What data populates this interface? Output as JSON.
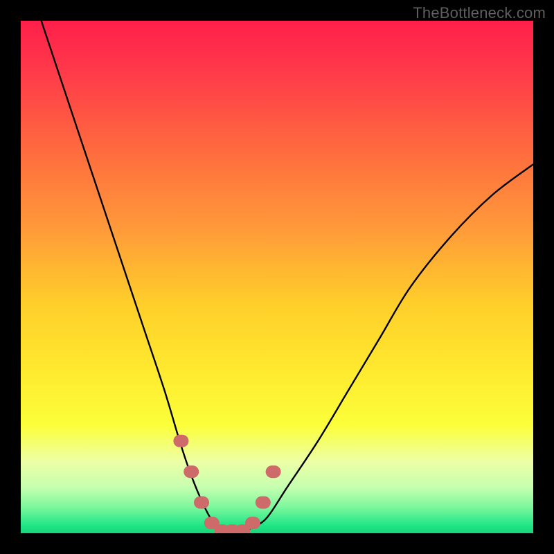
{
  "watermark": "TheBottleneck.com",
  "chart_data": {
    "type": "line",
    "title": "",
    "xlabel": "",
    "ylabel": "",
    "xlim": [
      0,
      100
    ],
    "ylim": [
      0,
      100
    ],
    "grid": false,
    "series": [
      {
        "name": "bottleneck-curve",
        "x": [
          4,
          8,
          12,
          16,
          20,
          24,
          28,
          31,
          33,
          35,
          37,
          39,
          41,
          43,
          45,
          48,
          52,
          58,
          64,
          70,
          76,
          84,
          92,
          100
        ],
        "y": [
          100,
          88,
          76,
          64,
          52,
          40,
          28,
          18,
          12,
          7,
          3,
          1,
          0.5,
          0.5,
          1,
          3,
          9,
          18,
          28,
          38,
          48,
          58,
          66,
          72
        ]
      }
    ],
    "markers": {
      "name": "bottom-highlight",
      "color": "#cf6a6b",
      "x": [
        31,
        33,
        35,
        37,
        39,
        41,
        43,
        45,
        47,
        49
      ],
      "y": [
        18,
        12,
        6,
        2,
        0.5,
        0.5,
        0.5,
        2,
        6,
        12
      ]
    },
    "gradient_stops": [
      {
        "offset": 0.0,
        "color": "#ff1f4a"
      },
      {
        "offset": 0.1,
        "color": "#ff3a4a"
      },
      {
        "offset": 0.25,
        "color": "#ff6a3e"
      },
      {
        "offset": 0.4,
        "color": "#ff983a"
      },
      {
        "offset": 0.55,
        "color": "#ffce2a"
      },
      {
        "offset": 0.68,
        "color": "#ffe92e"
      },
      {
        "offset": 0.79,
        "color": "#fbff3a"
      },
      {
        "offset": 0.86,
        "color": "#edffa6"
      },
      {
        "offset": 0.91,
        "color": "#c6ffb0"
      },
      {
        "offset": 0.95,
        "color": "#7af79c"
      },
      {
        "offset": 0.985,
        "color": "#1fe686"
      },
      {
        "offset": 1.0,
        "color": "#18d47a"
      }
    ]
  }
}
